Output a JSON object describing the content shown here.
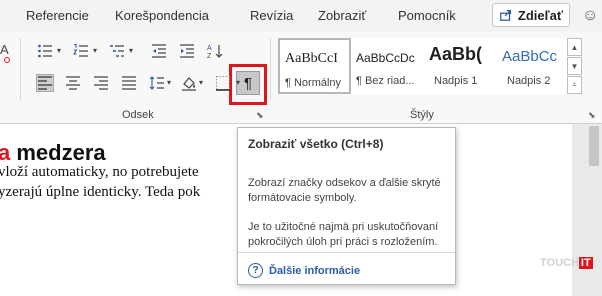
{
  "tabs": {
    "referencie": "Referencie",
    "korespondencia": "Korešpondencia",
    "revizia": "Revízia",
    "zobrazit": "Zobraziť",
    "pomocnik": "Pomocník"
  },
  "share_label": "Zdieľať",
  "ribbon": {
    "odsek_label": "Odsek",
    "styly_label": "Štýly",
    "pilcrow": "¶",
    "partial_font_glyph": "A",
    "styles": [
      {
        "preview": "AaBbCcI",
        "name": "¶ Normálny"
      },
      {
        "preview": "AaBbCcDc",
        "name": "¶ Bez riad..."
      },
      {
        "preview": "AaBb(",
        "name": "Nadpis 1"
      },
      {
        "preview": "AaBbCc",
        "name": "Nadpis 2"
      }
    ]
  },
  "document": {
    "heading_red": "a",
    "heading_rest": " medzera",
    "line1": "vloží automaticky, no potrebujete",
    "line2": "yzerajú úplne identicky. Teda pok"
  },
  "tooltip": {
    "title": "Zobraziť všetko (Ctrl+8)",
    "description": "Zobrazí značky odsekov a ďalšie skryté formátovacie symboly.",
    "note": "Je to užitočné najmä pri uskutočňovaní pokročilých úloh pri práci s rozložením.",
    "link": "Ďalšie informácie",
    "help_glyph": "?"
  },
  "watermark": {
    "text": "TOUCH",
    "accent": "IT"
  },
  "colors": {
    "highlight": "#e0141c",
    "link": "#2a5ea8",
    "heading2": "#2e6eb5"
  }
}
